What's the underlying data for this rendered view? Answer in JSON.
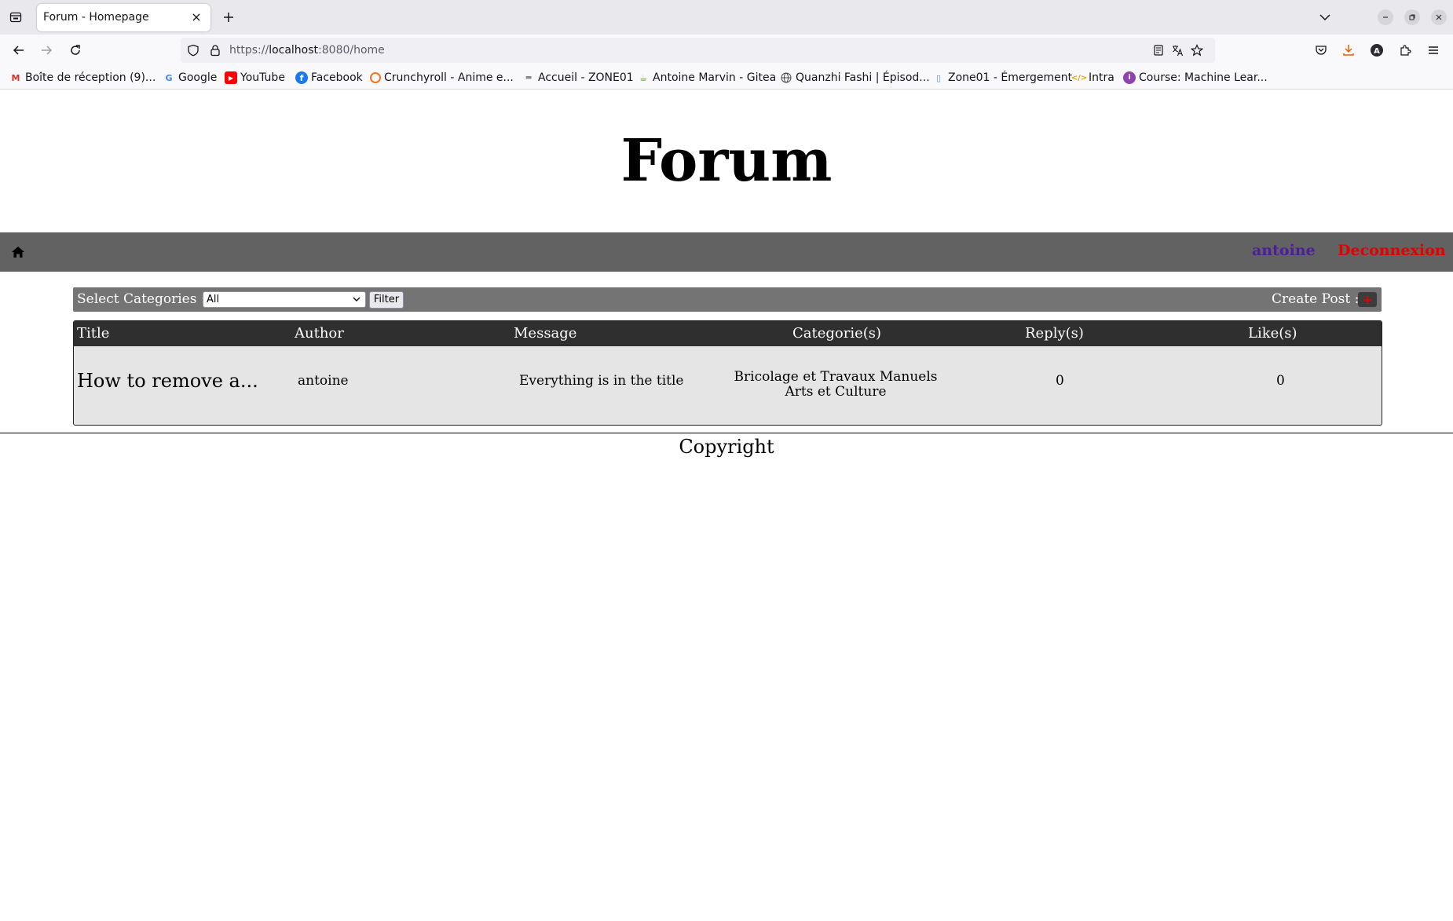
{
  "browser": {
    "tab_title": "Forum - Homepage",
    "url_prefix": "https://",
    "url_host": "localhost",
    "url_rest": ":8080/home",
    "bookmarks": [
      {
        "label": "Boîte de réception (9)...",
        "icon": "gmail-icon",
        "color": "#d93025"
      },
      {
        "label": "Google",
        "icon": "google-icon",
        "color": "#4285f4"
      },
      {
        "label": "YouTube",
        "icon": "youtube-icon",
        "color": "#ff0000"
      },
      {
        "label": "Facebook",
        "icon": "facebook-icon",
        "color": "#1877f2"
      },
      {
        "label": "Crunchyroll - Anime e...",
        "icon": "crunchyroll-icon",
        "color": "#f47521"
      },
      {
        "label": "Accueil - ZONE01",
        "icon": "zone01-icon",
        "color": "#888888"
      },
      {
        "label": "Antoine Marvin - Gitea",
        "icon": "gitea-icon",
        "color": "#609926"
      },
      {
        "label": "Quanzhi Fashi | Épisod...",
        "icon": "globe-icon",
        "color": "#444444"
      },
      {
        "label": "Zone01 - Émergement",
        "icon": "zone01-icon",
        "color": "#5b8def"
      },
      {
        "label": "Intra",
        "icon": "code-icon",
        "color": "#e8a100"
      },
      {
        "label": "Course: Machine Lear...",
        "icon": "course-icon",
        "color": "#8e44ad"
      }
    ]
  },
  "site": {
    "title": "Forum",
    "nav": {
      "user": "antoine",
      "logout": "Deconnexion"
    },
    "filter": {
      "label": "Select Categories :",
      "selected": "All",
      "button": "Filter",
      "create_label": "Create Post :"
    },
    "table": {
      "headers": [
        "Title",
        "Author",
        "Message",
        "Categorie(s)",
        "Reply(s)",
        "Like(s)"
      ],
      "rows": [
        {
          "title": "How to remove a...",
          "author": "antoine",
          "message": "Everything is in the title",
          "categories": [
            "Bricolage et Travaux Manuels",
            "Arts et Culture"
          ],
          "replies": "0",
          "likes": "0"
        }
      ]
    },
    "footer": "Copyright"
  },
  "colors": {
    "nav_bg": "#626262",
    "user_link": "#4c1f9a",
    "logout_link": "#e30000",
    "filter_bg": "#747474",
    "table_head_bg": "#2f2f2f",
    "table_body_bg": "#e5e5e5"
  }
}
